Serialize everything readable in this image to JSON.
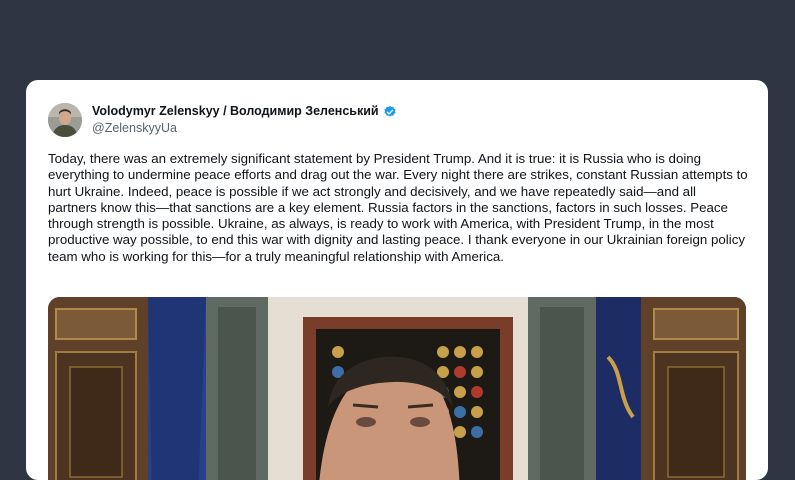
{
  "tweet": {
    "author_name": "Volodymyr Zelenskyy / Володимир Зеленський",
    "handle": "@ZelenskyyUa",
    "verified": true,
    "text": "Today, there was an extremely significant statement by President Trump. And it is true: it is Russia who is doing everything to undermine peace efforts and drag out the war. Every night there are strikes, constant Russian attempts to hurt Ukraine. Indeed, peace is possible if we act strongly and decisively, and we have repeatedly said—and all partners know this—that sanctions are a key element. Russia factors in the sanctions, factors in such losses. Peace through strength is possible. Ukraine, as always, is ready to work with America, with President Trump, in the most productive way possible, to end this war with dignity and lasting peace. I thank everyone in our Ukrainian foreign policy team who is working for this—for a truly meaningful relationship with America.",
    "media": {
      "type": "video-frame",
      "icon": "video-thumbnail"
    }
  },
  "colors": {
    "page_background": "#2f3542",
    "card_background": "#ffffff",
    "verified_badge": "#1d9bf0",
    "text_primary": "#0f1419",
    "text_secondary": "#536471"
  }
}
